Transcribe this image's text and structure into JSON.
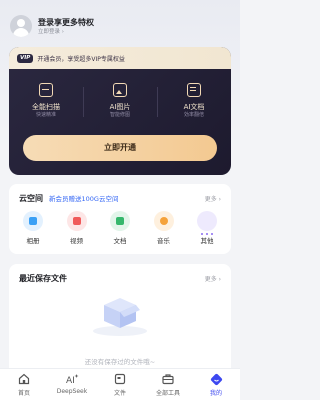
{
  "user": {
    "title": "登录享更多特权",
    "subtitle": "立即登录 ›"
  },
  "vip": {
    "badge": "VIP",
    "description": "开通会员，享受超多VIP专属权益",
    "features": [
      {
        "label": "全能扫描",
        "sub": "快速精准",
        "icon": "scan-icon"
      },
      {
        "label": "AI图片",
        "sub": "智能修图",
        "icon": "image-icon"
      },
      {
        "label": "AI文档",
        "sub": "効率翻倍",
        "icon": "document-icon"
      }
    ],
    "button_label": "立即开通"
  },
  "cloud": {
    "title": "云空间",
    "promo": "新会员赠送100G云空间",
    "more": "更多 ›",
    "items": [
      {
        "label": "相册",
        "icon": "album-icon",
        "color": "#3aa0f5"
      },
      {
        "label": "视频",
        "icon": "video-icon",
        "color": "#f05a5a"
      },
      {
        "label": "文档",
        "icon": "document-icon",
        "color": "#35b76c"
      },
      {
        "label": "音乐",
        "icon": "music-icon",
        "color": "#f5a23a"
      },
      {
        "label": "其他",
        "icon": "more-icon",
        "color": "#8a6cf0"
      }
    ]
  },
  "recent": {
    "title": "最近保存文件",
    "more": "更多 ›",
    "empty_text": "还没有保存过的文件哦~"
  },
  "tabs": [
    {
      "label": "首页",
      "icon": "home-icon",
      "active": false
    },
    {
      "label": "DeepSeek",
      "icon": "ai-icon",
      "active": false
    },
    {
      "label": "文件",
      "icon": "file-icon",
      "active": false
    },
    {
      "label": "全部工具",
      "icon": "toolbox-icon",
      "active": false
    },
    {
      "label": "我的",
      "icon": "profile-icon",
      "active": true
    }
  ],
  "colors": {
    "accent": "#3d48f0",
    "vip_dark": "#1d1a2e",
    "gold": "#f3c991",
    "promo": "#3467f5"
  }
}
